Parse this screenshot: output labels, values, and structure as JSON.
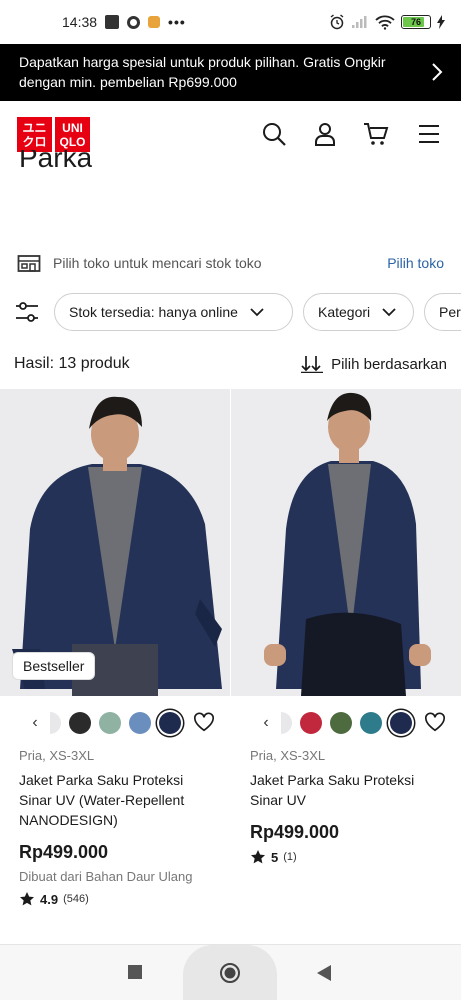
{
  "status_bar": {
    "time": "14:38",
    "dots": "•••",
    "battery": "76"
  },
  "promo": {
    "text": "Dapatkan harga spesial untuk produk pilihan. Gratis Ongkir dengan min. pembelian Rp699.000"
  },
  "header": {
    "logo_top": "UNI",
    "logo_bottom": "QLO",
    "logo_jp_top": "ユニ",
    "logo_jp_bottom": "クロ"
  },
  "page_title": "Parka",
  "store": {
    "text": "Pilih toko untuk mencari stok toko",
    "link": "Pilih toko"
  },
  "filters": {
    "chips": [
      "Stok tersedia: hanya online",
      "Kategori",
      "Per"
    ]
  },
  "results": {
    "count_text": "Hasil: 13 produk",
    "sort_label": "Pilih berdasarkan"
  },
  "products": [
    {
      "badge": "Bestseller",
      "swatch_arrow": "‹",
      "swatch_colors": [
        "#e8e8ea",
        "#2b2b2b",
        "#8fb2a2",
        "#6a8fbf",
        "#1e2b4e"
      ],
      "meta": "Pria, XS-3XL",
      "name": "Jaket Parka Saku Proteksi Sinar UV (Water-Repellent NANODESIGN)",
      "price": "Rp499.000",
      "sub": "Dibuat dari Bahan Daur Ulang",
      "rating": "4.9",
      "reviews": "(546)"
    },
    {
      "badge": "",
      "swatch_arrow": "‹",
      "swatch_colors": [
        "#c2283d",
        "#4e6b3f",
        "#2e7b8c",
        "#1e2b4e"
      ],
      "meta": "Pria, XS-3XL",
      "name": "Jaket Parka Saku Proteksi Sinar UV",
      "price": "Rp499.000",
      "sub": "",
      "rating": "5",
      "reviews": "(1)"
    }
  ],
  "colors": {
    "brand_red": "#e60012",
    "link_blue": "#2b63a6",
    "jacket_navy": "#1e2b4e"
  }
}
